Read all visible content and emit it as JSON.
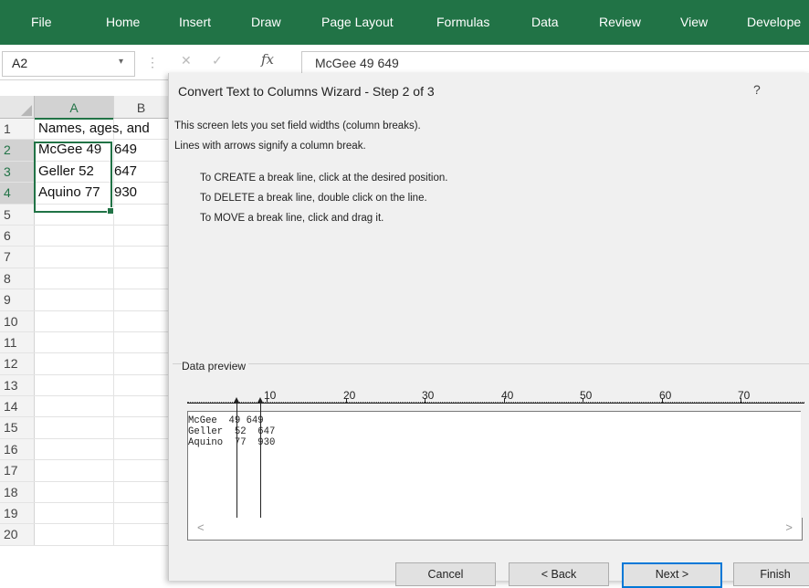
{
  "ribbon": {
    "tabs": [
      "File",
      "Home",
      "Insert",
      "Draw",
      "Page Layout",
      "Formulas",
      "Data",
      "Review",
      "View",
      "Develope"
    ],
    "color": "#217346"
  },
  "formula_bar": {
    "name_box": "A2",
    "fx_icon": "fx-icon",
    "formula": "McGee 49 649"
  },
  "grid": {
    "columns": [
      "A",
      "B"
    ],
    "rows": [
      {
        "n": "1",
        "a": "Names, ages, and",
        "b": ""
      },
      {
        "n": "2",
        "a": "McGee 49",
        "b": "649"
      },
      {
        "n": "3",
        "a": "Geller 52",
        "b": "647"
      },
      {
        "n": "4",
        "a": "Aquino 77",
        "b": "930"
      },
      {
        "n": "5",
        "a": "",
        "b": ""
      },
      {
        "n": "6",
        "a": "",
        "b": ""
      },
      {
        "n": "7",
        "a": "",
        "b": ""
      },
      {
        "n": "8",
        "a": "",
        "b": ""
      },
      {
        "n": "9",
        "a": "",
        "b": ""
      },
      {
        "n": "10",
        "a": "",
        "b": ""
      },
      {
        "n": "11",
        "a": "",
        "b": ""
      },
      {
        "n": "12",
        "a": "",
        "b": ""
      },
      {
        "n": "13",
        "a": "",
        "b": ""
      },
      {
        "n": "14",
        "a": "",
        "b": ""
      },
      {
        "n": "15",
        "a": "",
        "b": ""
      },
      {
        "n": "16",
        "a": "",
        "b": ""
      },
      {
        "n": "17",
        "a": "",
        "b": ""
      },
      {
        "n": "18",
        "a": "",
        "b": ""
      },
      {
        "n": "19",
        "a": "",
        "b": ""
      },
      {
        "n": "20",
        "a": "",
        "b": ""
      }
    ]
  },
  "dialog": {
    "title": "Convert Text to Columns Wizard - Step 2 of 3",
    "help": "?",
    "intro_1": "This screen lets you set field widths (column breaks).",
    "intro_2": "Lines with arrows signify a column break.",
    "instr_1": "To CREATE a break line, click at the desired position.",
    "instr_2": "To DELETE a break line, double click on the line.",
    "instr_3": "To MOVE a break line, click and drag it.",
    "preview_label": "Data preview",
    "ruler_numbers": [
      "10",
      "20",
      "30",
      "40",
      "50",
      "60",
      "70"
    ],
    "preview_lines": [
      "McGee  49 649",
      "Geller  52  647",
      "Aquino  77  930"
    ],
    "break_positions": [
      7,
      10
    ],
    "buttons": {
      "cancel": "Cancel",
      "back": "< Back",
      "next": "Next >",
      "finish": "Finish"
    }
  }
}
